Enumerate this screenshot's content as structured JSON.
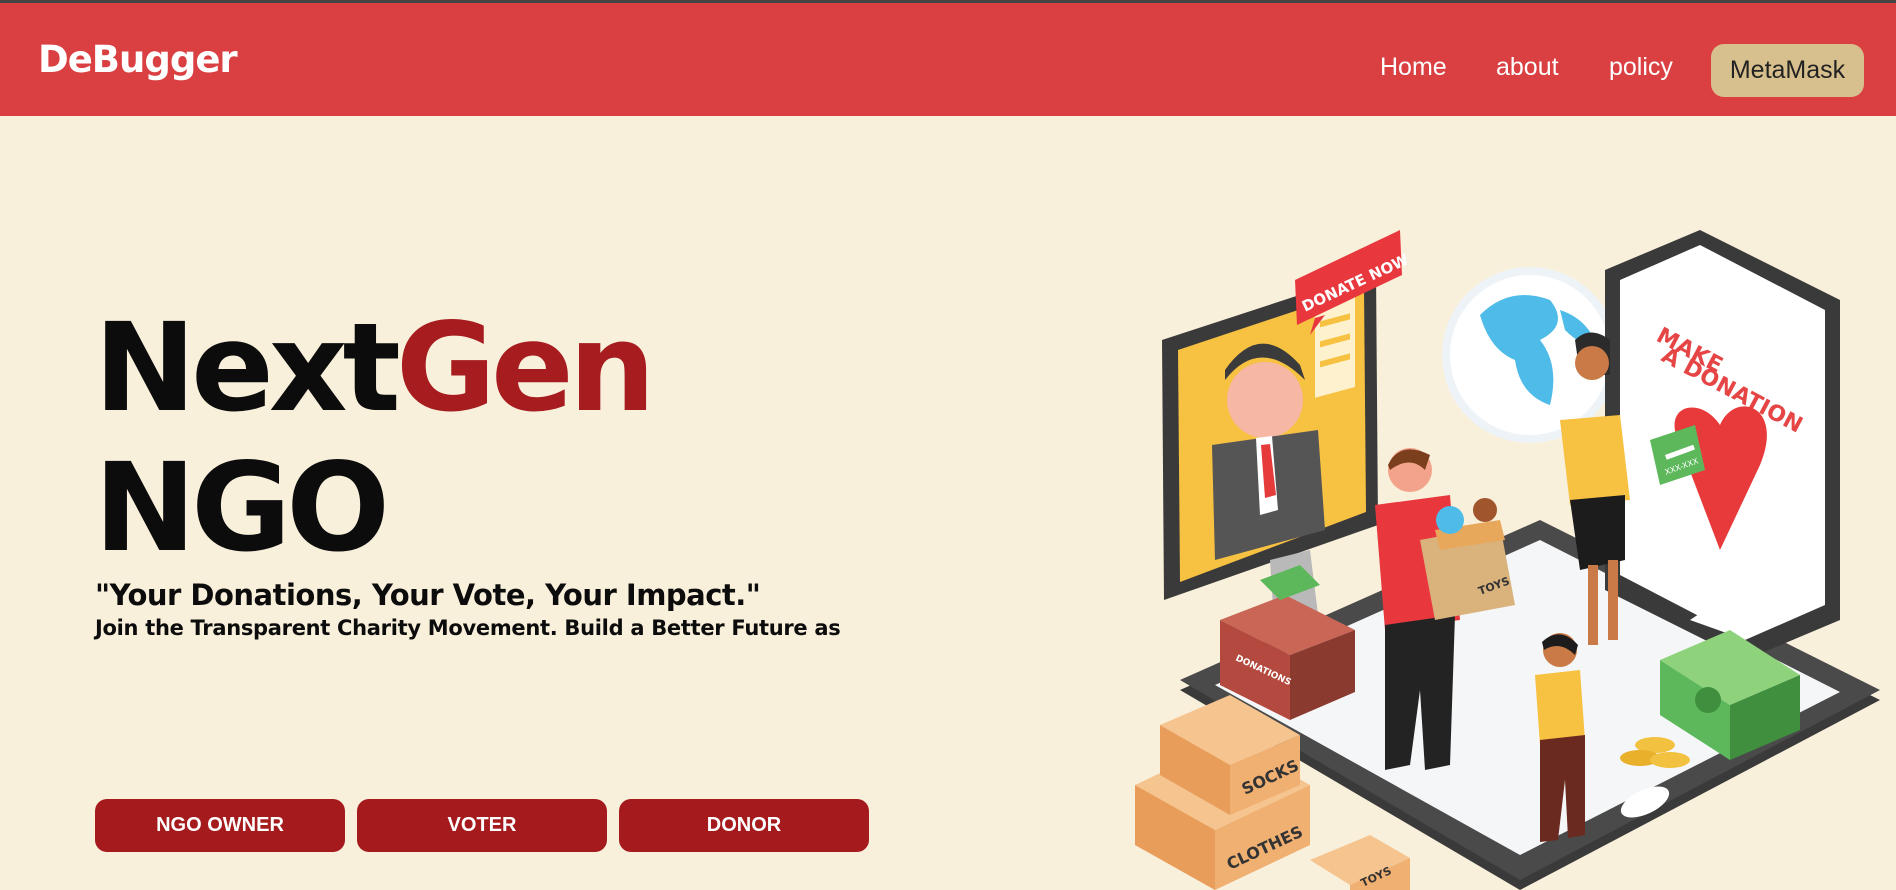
{
  "header": {
    "brand": "DeBugger",
    "nav": {
      "home": "Home",
      "about": "about",
      "policy": "policy"
    },
    "wallet_button": "MetaMask"
  },
  "hero": {
    "title_part1": "Next",
    "title_part2": "Gen",
    "title_line2": "NGO",
    "tagline": "\"Your Donations, Your Vote, Your Impact.\"",
    "subtagline": "Join the Transparent Charity Movement. Build a Better Future as",
    "buttons": {
      "owner": "NGO OWNER",
      "voter": "VOTER",
      "donor": "DONOR"
    }
  },
  "illustration": {
    "donate_sign": "DONATE NOW",
    "tablet_text_line1": "MAKE",
    "tablet_text_line2": "A DONATION",
    "card_text": "XXX-XXX",
    "box_toys": "TOYS",
    "box_donations": "DONATIONS",
    "box_socks": "SOCKS",
    "box_clothes": "CLOTHES",
    "box_toys_small": "TOYS"
  },
  "colors": {
    "navbar": "#da4042",
    "background": "#f9f0dc",
    "accent": "#a61c1f",
    "wallet_button": "#d8c08e"
  }
}
